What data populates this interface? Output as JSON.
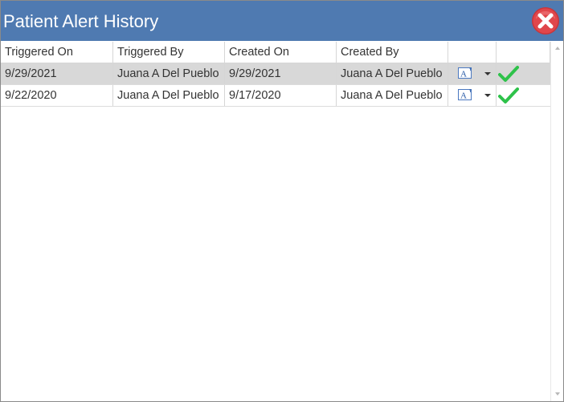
{
  "window": {
    "title": "Patient Alert History"
  },
  "icons": {
    "close": "close-icon",
    "font": "font-icon",
    "dropdown": "chevron-down-icon",
    "check": "checkmark-icon"
  },
  "colors": {
    "titlebar": "#4f7ab1",
    "close_button": "#e0464b",
    "check": "#2ec24a",
    "selected_row": "#d8d8d8"
  },
  "grid": {
    "columns": [
      "Triggered On",
      "Triggered By",
      "Created On",
      "Created By",
      "",
      ""
    ],
    "rows": [
      {
        "triggered_on": "9/29/2021",
        "triggered_by": "Juana A Del Pueblo",
        "created_on": "9/29/2021",
        "created_by": "Juana A Del Pueblo",
        "selected": true
      },
      {
        "triggered_on": "9/22/2020",
        "triggered_by": "Juana A Del Pueblo",
        "created_on": "9/17/2020",
        "created_by": "Juana A Del Pueblo",
        "selected": false
      }
    ]
  }
}
